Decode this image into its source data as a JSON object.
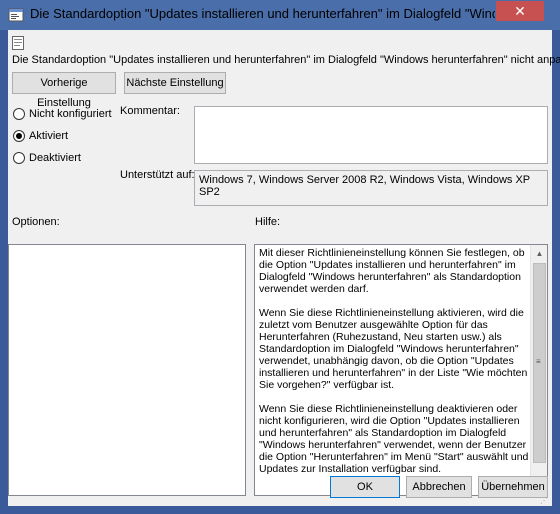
{
  "window": {
    "title": "Die Standardoption \"Updates installieren und herunterfahren\" im Dialogfeld \"Wind...",
    "close_glyph": "✕",
    "app_icon": "policy-settings-icon"
  },
  "header": {
    "policy_icon": "policy-document-icon",
    "heading": "Die Standardoption \"Updates installieren und herunterfahren\" im Dialogfeld \"Windows herunterfahren\" nicht anpassen"
  },
  "nav": {
    "prev_label": "Vorherige Einstellung",
    "next_label": "Nächste Einstellung"
  },
  "state": {
    "options": [
      {
        "label": "Nicht konfiguriert",
        "checked": false
      },
      {
        "label": "Aktiviert",
        "checked": true
      },
      {
        "label": "Deaktiviert",
        "checked": false
      }
    ]
  },
  "comment": {
    "label": "Kommentar:",
    "value": ""
  },
  "supported": {
    "label": "Unterstützt auf:",
    "value": "Windows 7, Windows Server 2008 R2, Windows Vista, Windows XP SP2"
  },
  "panels": {
    "options_label": "Optionen:",
    "help_label": "Hilfe:"
  },
  "help": {
    "paragraphs": [
      "Mit dieser Richtlinieneinstellung können Sie festlegen, ob die Option \"Updates installieren und herunterfahren\" im Dialogfeld \"Windows herunterfahren\" als Standardoption verwendet werden darf.",
      "Wenn Sie diese Richtlinieneinstellung aktivieren, wird die zuletzt vom Benutzer ausgewählte Option für das Herunterfahren (Ruhezustand, Neu starten usw.) als Standardoption im Dialogfeld \"Windows herunterfahren\" verwendet, unabhängig davon, ob die Option \"Updates installieren und herunterfahren\" in der Liste \"Wie möchten Sie vorgehen?\" verfügbar ist.",
      "Wenn Sie diese Richtlinieneinstellung deaktivieren oder nicht konfigurieren, wird die Option \"Updates installieren und herunterfahren\" als Standardoption im Dialogfeld \"Windows herunterfahren\" verwendet, wenn der Benutzer die Option \"Herunterfahren\" im Menü \"Start\" auswählt und Updates zur Installation verfügbar sind."
    ]
  },
  "footer": {
    "ok_label": "OK",
    "cancel_label": "Abbrechen",
    "apply_label": "Übernehmen"
  },
  "colors": {
    "titlebar": "#4a6ea9",
    "close": "#c75050",
    "dialog_bg": "#f0f0f0"
  }
}
